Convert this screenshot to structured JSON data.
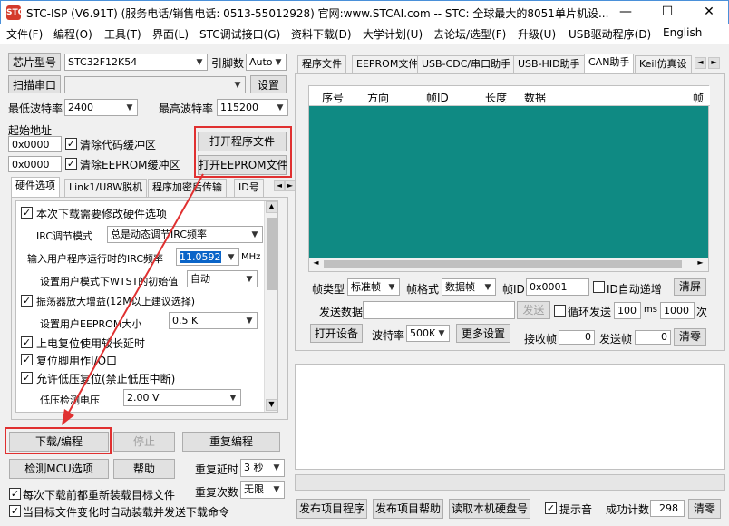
{
  "title": "STC-ISP (V6.91T) (服务电话/销售电话: 0513-55012928) 官网:www.STCAI.com  -- STC: 全球最大的8051单片机设...",
  "logo_text": "STC",
  "window_controls": {
    "min": "—",
    "max": "☐",
    "close": "✕"
  },
  "menu": [
    "文件(F)",
    "编程(O)",
    "工具(T)",
    "界面(L)",
    "STC调试接口(G)",
    "资料下载(D)",
    "大学计划(U)",
    "去论坛/选型(F)",
    "升级(U)",
    "USB驱动程序(D)",
    "English"
  ],
  "left": {
    "chip_type_btn": "芯片型号",
    "chip_type_value": "STC32F12K54",
    "pin_count_label": "引脚数",
    "pin_count_value": "Auto",
    "scan_port_btn": "扫描串口",
    "port_value": "",
    "settings_btn": "设置",
    "min_baud_label": "最低波特率",
    "min_baud_value": "2400",
    "max_baud_label": "最高波特率",
    "max_baud_value": "115200",
    "start_addr_label": "起始地址",
    "addr1_value": "0x0000",
    "clear_code_label": "清除代码缓冲区",
    "addr2_value": "0x0000",
    "clear_eeprom_label": "清除EEPROM缓冲区",
    "open_program_btn": "打开程序文件",
    "open_eeprom_btn": "打开EEPROM文件",
    "tabs": [
      "硬件选项",
      "Link1/U8W脱机",
      "程序加密后传输",
      "ID号"
    ],
    "hw": {
      "opt1": "本次下载需要修改硬件选项",
      "irc_mode_label": "IRC调节模式",
      "irc_mode_value": "总是动态调节IRC频率",
      "irc_freq_label": "输入用户程序运行时的IRC频率",
      "irc_freq_value": "11.0592",
      "irc_freq_unit": "MHz",
      "wst_label": "设置用户模式下WTST的初始值",
      "wst_value": "自动",
      "osc_label": "振荡器放大增益(12M以上建议选择)",
      "eeprom_size_label": "设置用户EEPROM大小",
      "eeprom_size_value": "0.5 K",
      "opt_delay": "上电复位使用较长延时",
      "opt_reset_io": "复位脚用作I/O口",
      "opt_lvr": "允许低压复位(禁止低压中断)",
      "lvd_label": "低压检测电压",
      "lvd_value": "2.00 V"
    },
    "download_btn": "下载/编程",
    "stop_btn": "停止",
    "reprogram_btn": "重复编程",
    "check_mcu_btn": "检测MCU选项",
    "help_btn": "帮助",
    "repeat_delay_label": "重复延时",
    "repeat_delay_value": "3 秒",
    "repeat_count_label": "重复次数",
    "repeat_count_value": "无限",
    "reload_label": "每次下载前都重新装载目标文件",
    "auto_send_label": "当目标文件变化时自动装载并发送下载命令"
  },
  "right": {
    "tabs": [
      "程序文件",
      "EEPROM文件",
      "USB-CDC/串口助手",
      "USB-HID助手",
      "CAN助手",
      "Keil仿真设"
    ],
    "table_headers": [
      "序号",
      "方向",
      "帧ID",
      "长度",
      "数据",
      "帧"
    ],
    "frame_type_label": "帧类型",
    "frame_type_value": "标准帧",
    "frame_format_label": "帧格式",
    "frame_format_value": "数据帧",
    "frame_id_label": "帧ID",
    "frame_id_value": "0x0001",
    "id_auto_label": "ID自动递增",
    "clear_screen_btn": "清屏",
    "send_data_label": "发送数据",
    "send_data_value": "",
    "send_btn": "发送",
    "loop_send_label": "循环发送",
    "loop_ms_value": "100",
    "ms_unit": "ms",
    "loop_times_value": "1000",
    "times_unit": "次",
    "open_device_btn": "打开设备",
    "baud_label": "波特率",
    "baud_value": "500K",
    "more_settings_btn": "更多设置",
    "rx_label": "接收帧",
    "rx_value": "0",
    "tx_label": "发送帧",
    "tx_value": "0",
    "clear_zero_btn": "清零",
    "publish_program_btn": "发布项目程序",
    "publish_help_btn": "发布项目帮助",
    "read_disk_btn": "读取本机硬盘号",
    "sound_label": "提示音",
    "success_count_label": "成功计数",
    "success_count_value": "298",
    "clear_count_btn": "清零"
  }
}
